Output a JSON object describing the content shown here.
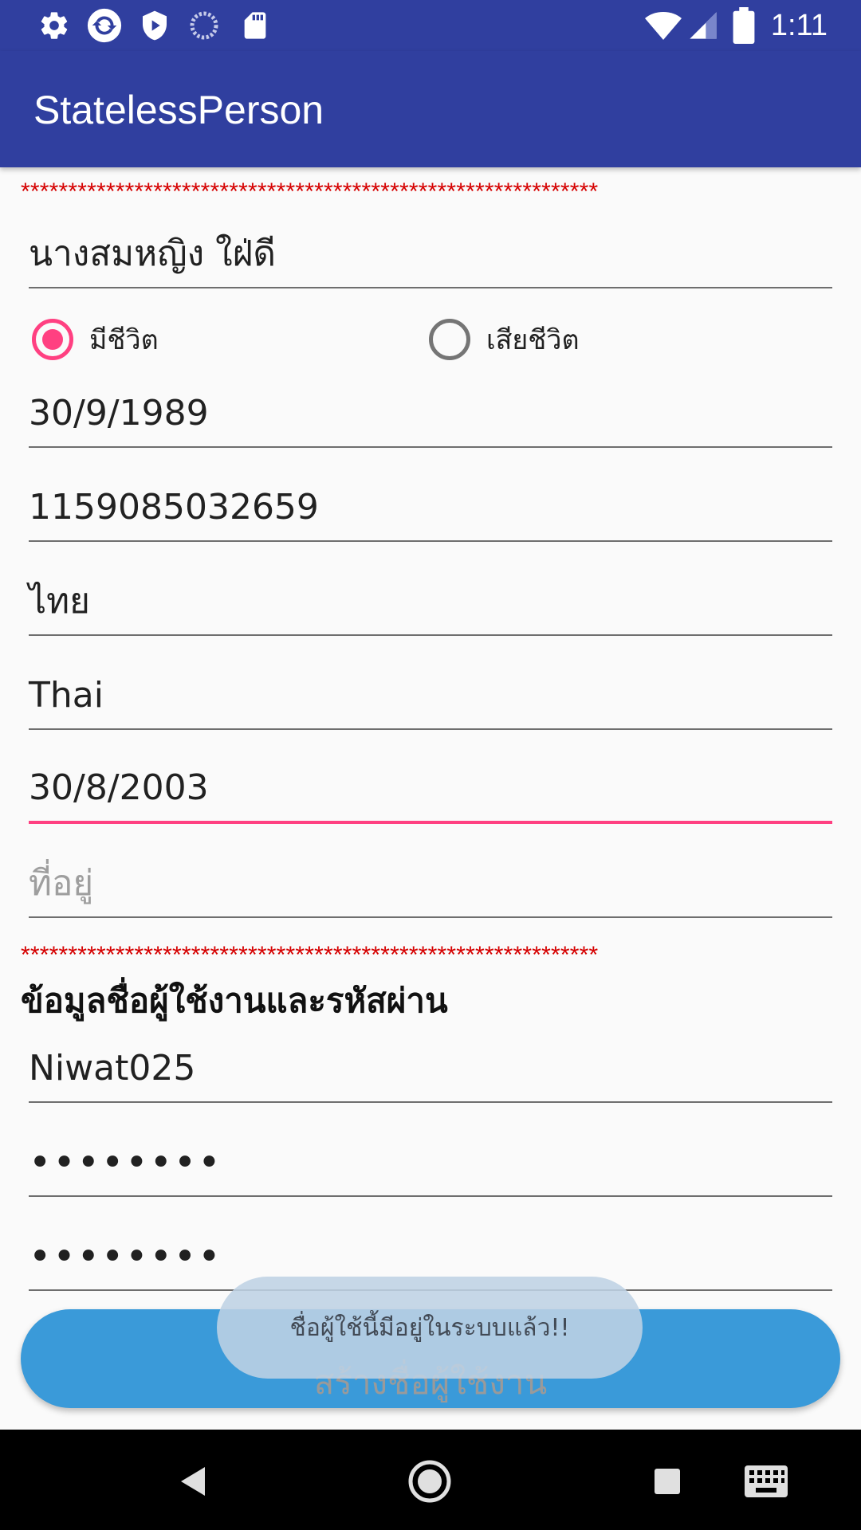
{
  "status_bar": {
    "time": "1:11",
    "left_icons": [
      "settings-icon",
      "sync-icon",
      "play-shield-icon",
      "loading-icon",
      "sd-card-icon"
    ],
    "right_icons": [
      "wifi-icon",
      "signal-icon",
      "battery-icon"
    ]
  },
  "app_bar": {
    "title": "StatelessPerson"
  },
  "stars_top": "*************************************************************",
  "form": {
    "full_name": "นางสมหญิง ใฝ่ดี",
    "status_alive_label": "มีชีวิต",
    "status_dead_label": "เสียชีวิต",
    "status_selected": "alive",
    "birth_date": "30/9/1989",
    "id_number": "1159085032659",
    "nationality_th": "ไทย",
    "nationality_en": "Thai",
    "issue_date": "30/8/2003",
    "address_hint": "ที่อยู่"
  },
  "stars_bottom": "*************************************************************",
  "account": {
    "section_title": "ข้อมูลชื่อผู้ใช้งานและรหัสผ่าน",
    "username": "Niwat025",
    "password": "••••••••",
    "confirm_password": "••••••••",
    "create_button_label": "สร้างชื่อผู้ใช้งาน"
  },
  "toast": {
    "message": "ชื่อผู้ใช้นี้มีอยู่ในระบบแล้ว!!"
  },
  "nav_bar": {
    "buttons": [
      "back-icon",
      "home-icon",
      "recents-icon",
      "keyboard-icon"
    ]
  },
  "colors": {
    "primary": "#303f9f",
    "accent": "#ff4081",
    "button": "#3a9ad9",
    "stars": "#d50000"
  }
}
